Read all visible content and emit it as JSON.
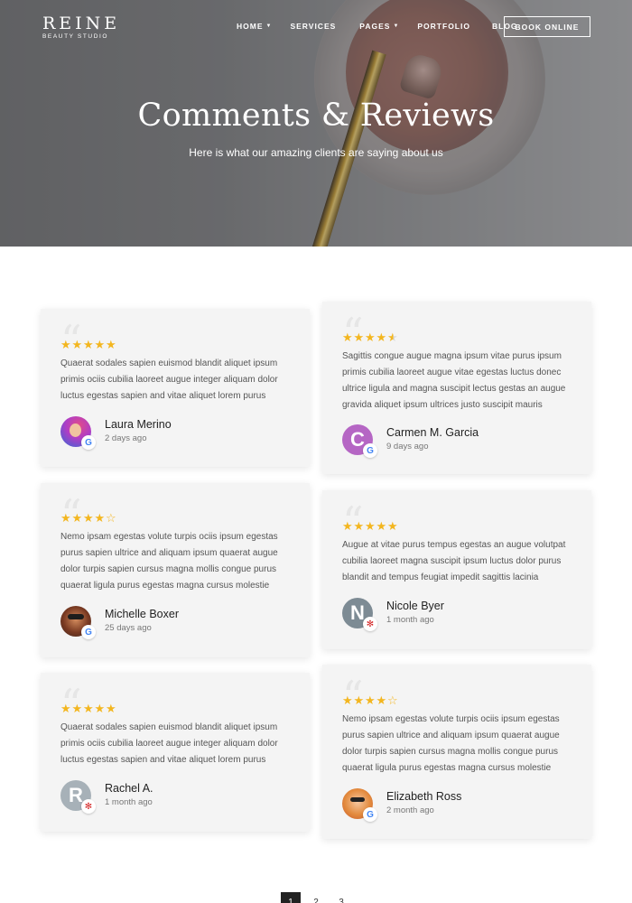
{
  "brand": {
    "name": "REINE",
    "tagline": "BEAUTY STUDIO"
  },
  "nav": {
    "items": [
      {
        "label": "HOME",
        "dropdown": true
      },
      {
        "label": "SERVICES",
        "dropdown": false
      },
      {
        "label": "PAGES",
        "dropdown": true
      },
      {
        "label": "PORTFOLIO",
        "dropdown": false
      },
      {
        "label": "BLOG",
        "dropdown": false
      }
    ],
    "cta": "BOOK ONLINE"
  },
  "hero": {
    "title": "Comments & Reviews",
    "subtitle": "Here is what our amazing clients are saying about us"
  },
  "colors": {
    "star": "#f3b61f",
    "card_bg": "#f4f4f4",
    "accent_dark": "#222222"
  },
  "reviews": [
    {
      "rating": 5,
      "text": "Quaerat sodales sapien euismod blandit aliquet ipsum primis ociis cubilia laoreet augue integer aliquam dolor luctus egestas sapien and vitae aliquet lorem purus",
      "name": "Laura Merino",
      "date": "2 days ago",
      "source": "google-icon",
      "avatar": "photo"
    },
    {
      "rating": 4.5,
      "text": "Sagittis congue augue magna ipsum vitae purus ipsum primis cubilia laoreet augue vitae egestas luctus donec ultrice ligula and magna suscipit lectus gestas an augue gravida aliquet ipsum ultrices justo suscipit mauris",
      "name": "Carmen M. Garcia",
      "date": "9 days ago",
      "source": "google-icon",
      "avatar": "C",
      "avatar_color": "#b566c4"
    },
    {
      "rating": 4,
      "text": "Nemo ipsam egestas volute turpis ociis ipsum egestas purus sapien ultrice and aliquam ipsum quaerat augue dolor turpis sapien cursus magna mollis congue purus quaerat ligula purus egestas magna cursus molestie",
      "name": "Michelle Boxer",
      "date": "25 days ago",
      "source": "google-icon",
      "avatar": "photo"
    },
    {
      "rating": 5,
      "text": "Augue at vitae purus tempus egestas an augue volutpat cubilia laoreet magna suscipit ipsum luctus dolor purus blandit and tempus feugiat impedit sagittis lacinia",
      "name": "Nicole Byer",
      "date": "1 month ago",
      "source": "yelp-icon",
      "avatar": "N",
      "avatar_color": "#7d8b94"
    },
    {
      "rating": 5,
      "text": "Quaerat sodales sapien euismod blandit aliquet ipsum primis ociis cubilia laoreet augue integer aliquam dolor luctus egestas sapien and vitae aliquet lorem purus",
      "name": "Rachel A.",
      "date": "1 month ago",
      "source": "yelp-icon",
      "avatar": "R",
      "avatar_color": "#a7b1b8"
    },
    {
      "rating": 4,
      "text": "Nemo ipsam egestas volute turpis ociis ipsum egestas purus sapien ultrice and aliquam ipsum quaerat augue dolor turpis sapien cursus magna mollis congue purus quaerat ligula purus egestas magna cursus molestie",
      "name": "Elizabeth Ross",
      "date": "2 month ago",
      "source": "google-icon",
      "avatar": "photo"
    }
  ],
  "pagination": {
    "pages": [
      "1",
      "2",
      "3"
    ],
    "current": "1"
  }
}
